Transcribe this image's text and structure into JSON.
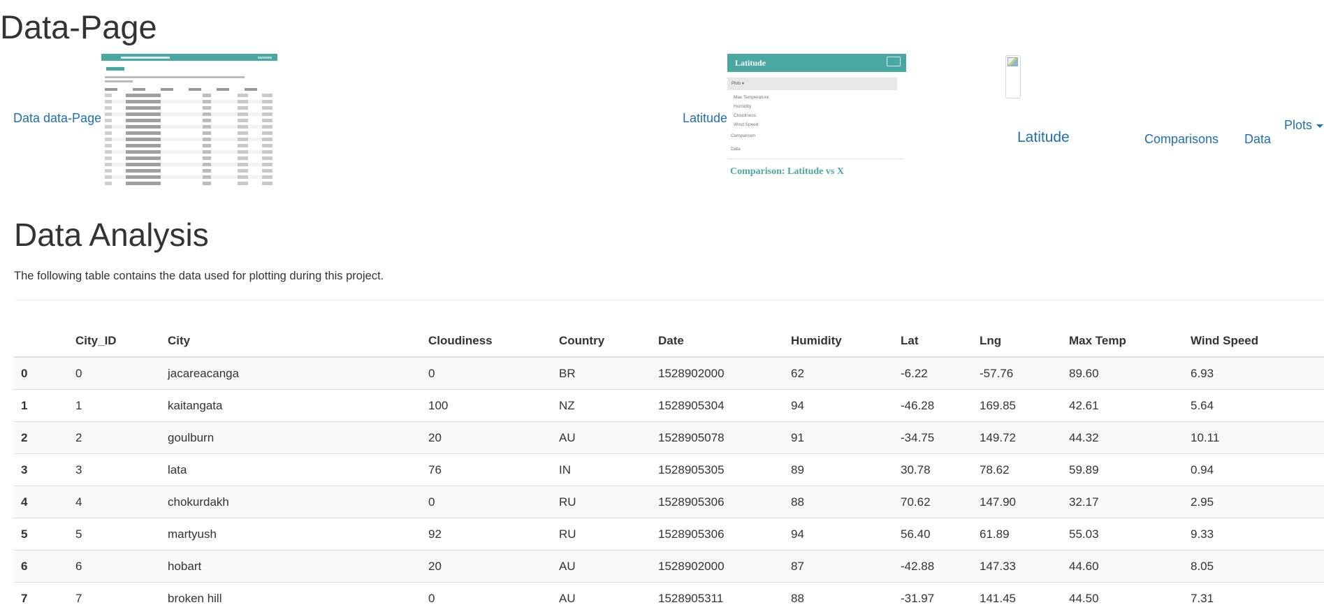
{
  "page_heading": "Data-Page",
  "nav": {
    "data_page_link": "Data data-Page",
    "latitude_link": "Latitude",
    "latitude_big": "Latitude",
    "comparisons": "Comparisons",
    "data": "Data",
    "plots": "Plots"
  },
  "thumb_latitude": {
    "bar_title": "Latitude",
    "dropdown": "Plots ▾",
    "items": [
      "Max Temperature",
      "Humidity",
      "Cloudiness",
      "Wind Speed"
    ],
    "comparison_item": "Comparison",
    "data_item": "Data",
    "comparison_heading": "Comparison: Latitude vs X"
  },
  "main": {
    "title": "Data Analysis",
    "lead": "The following table contains the data used for plotting during this project."
  },
  "table": {
    "columns": [
      "",
      "City_ID",
      "City",
      "Cloudiness",
      "Country",
      "Date",
      "Humidity",
      "Lat",
      "Lng",
      "Max Temp",
      "Wind Speed"
    ],
    "rows": [
      [
        "0",
        "0",
        "jacareacanga",
        "0",
        "BR",
        "1528902000",
        "62",
        "-6.22",
        "-57.76",
        "89.60",
        "6.93"
      ],
      [
        "1",
        "1",
        "kaitangata",
        "100",
        "NZ",
        "1528905304",
        "94",
        "-46.28",
        "169.85",
        "42.61",
        "5.64"
      ],
      [
        "2",
        "2",
        "goulburn",
        "20",
        "AU",
        "1528905078",
        "91",
        "-34.75",
        "149.72",
        "44.32",
        "10.11"
      ],
      [
        "3",
        "3",
        "lata",
        "76",
        "IN",
        "1528905305",
        "89",
        "30.78",
        "78.62",
        "59.89",
        "0.94"
      ],
      [
        "4",
        "4",
        "chokurdakh",
        "0",
        "RU",
        "1528905306",
        "88",
        "70.62",
        "147.90",
        "32.17",
        "2.95"
      ],
      [
        "5",
        "5",
        "martyush",
        "92",
        "RU",
        "1528905306",
        "94",
        "56.40",
        "61.89",
        "55.03",
        "9.33"
      ],
      [
        "6",
        "6",
        "hobart",
        "20",
        "AU",
        "1528902000",
        "87",
        "-42.88",
        "147.33",
        "44.60",
        "8.05"
      ],
      [
        "7",
        "7",
        "broken hill",
        "0",
        "AU",
        "1528905311",
        "88",
        "-31.97",
        "141.45",
        "44.50",
        "7.31"
      ]
    ]
  }
}
